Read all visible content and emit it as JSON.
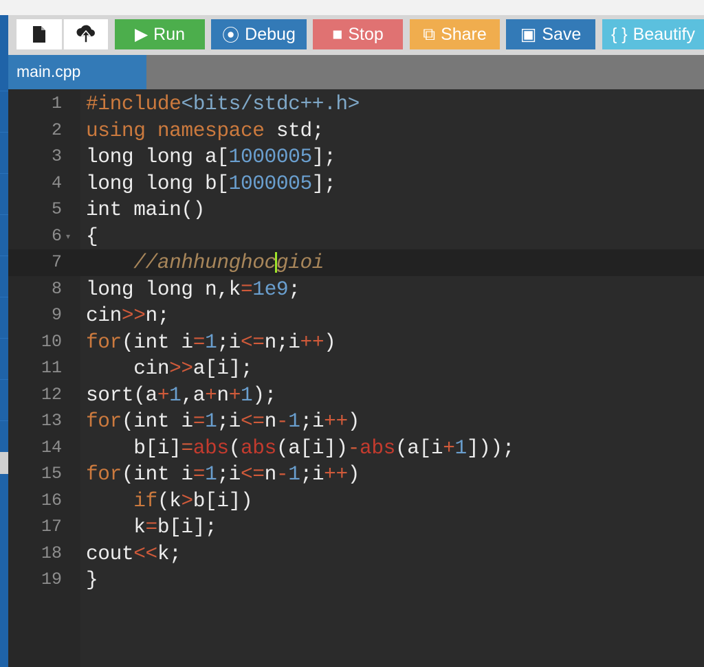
{
  "toolbar": {
    "new_file_icon": "file-icon",
    "upload_icon": "cloud-upload-icon",
    "buttons": [
      {
        "label": "Run",
        "icon": "▶",
        "color": "#4cae4c"
      },
      {
        "label": "Debug",
        "icon": "⦿",
        "color": "#337ab7"
      },
      {
        "label": "Stop",
        "icon": "■",
        "color": "#e07272"
      },
      {
        "label": "Share",
        "icon": "⧉",
        "color": "#f0ad4e"
      },
      {
        "label": "Save",
        "icon": "▣",
        "color": "#337ab7"
      },
      {
        "label": "Beautify",
        "icon": "{ }",
        "color": "#5bc0de"
      }
    ]
  },
  "tabs": [
    {
      "label": "main.cpp",
      "active": true
    }
  ],
  "editor": {
    "active_line": 7,
    "lines": [
      [
        [
          "#include",
          "kw"
        ],
        [
          "<bits/stdc++.h>",
          "str"
        ]
      ],
      [
        [
          "using namespace",
          "kw"
        ],
        [
          " std;",
          "pl"
        ]
      ],
      [
        [
          "long long a[",
          "pl"
        ],
        [
          "1000005",
          "num"
        ],
        [
          "];",
          "pl"
        ]
      ],
      [
        [
          "long long b[",
          "pl"
        ],
        [
          "1000005",
          "num"
        ],
        [
          "];",
          "pl"
        ]
      ],
      [
        [
          "int main()",
          "pl"
        ]
      ],
      [
        [
          "{",
          "pl"
        ]
      ],
      [
        [
          "    //anhhunghoc",
          "cm"
        ],
        [
          "|",
          "cursor"
        ],
        [
          "gioi",
          "cm"
        ]
      ],
      [
        [
          "long long n,k",
          "pl"
        ],
        [
          "=",
          "op"
        ],
        [
          "1e9",
          "num"
        ],
        [
          ";",
          "pl"
        ]
      ],
      [
        [
          "cin",
          "pl"
        ],
        [
          ">>",
          "op"
        ],
        [
          "n;",
          "pl"
        ]
      ],
      [
        [
          "for",
          "kw"
        ],
        [
          "(int i",
          "pl"
        ],
        [
          "=",
          "op"
        ],
        [
          "1",
          "num"
        ],
        [
          ";i",
          "pl"
        ],
        [
          "<=",
          "op"
        ],
        [
          "n;i",
          "pl"
        ],
        [
          "++",
          "op"
        ],
        [
          ")",
          "pl"
        ]
      ],
      [
        [
          "    cin",
          "pl"
        ],
        [
          ">>",
          "op"
        ],
        [
          "a[i];",
          "pl"
        ]
      ],
      [
        [
          "sort(a",
          "pl"
        ],
        [
          "+",
          "op"
        ],
        [
          "1",
          "num"
        ],
        [
          ",a",
          "pl"
        ],
        [
          "+",
          "op"
        ],
        [
          "n",
          "pl"
        ],
        [
          "+",
          "op"
        ],
        [
          "1",
          "num"
        ],
        [
          ");",
          "pl"
        ]
      ],
      [
        [
          "for",
          "kw"
        ],
        [
          "(int i",
          "pl"
        ],
        [
          "=",
          "op"
        ],
        [
          "1",
          "num"
        ],
        [
          ";i",
          "pl"
        ],
        [
          "<=",
          "op"
        ],
        [
          "n",
          "pl"
        ],
        [
          "-",
          "op"
        ],
        [
          "1",
          "num"
        ],
        [
          ";i",
          "pl"
        ],
        [
          "++",
          "op"
        ],
        [
          ")",
          "pl"
        ]
      ],
      [
        [
          "    b[i]",
          "pl"
        ],
        [
          "=",
          "op"
        ],
        [
          "abs",
          "fn"
        ],
        [
          "(",
          "pl"
        ],
        [
          "abs",
          "fn"
        ],
        [
          "(a[i])",
          "pl"
        ],
        [
          "-",
          "op"
        ],
        [
          "abs",
          "fn"
        ],
        [
          "(a[i",
          "pl"
        ],
        [
          "+",
          "op"
        ],
        [
          "1",
          "num"
        ],
        [
          "]));",
          "pl"
        ]
      ],
      [
        [
          "for",
          "kw"
        ],
        [
          "(int i",
          "pl"
        ],
        [
          "=",
          "op"
        ],
        [
          "1",
          "num"
        ],
        [
          ";i",
          "pl"
        ],
        [
          "<=",
          "op"
        ],
        [
          "n",
          "pl"
        ],
        [
          "-",
          "op"
        ],
        [
          "1",
          "num"
        ],
        [
          ";i",
          "pl"
        ],
        [
          "++",
          "op"
        ],
        [
          ")",
          "pl"
        ]
      ],
      [
        [
          "    ",
          "pl"
        ],
        [
          "if",
          "kw"
        ],
        [
          "(k",
          "pl"
        ],
        [
          ">",
          "op"
        ],
        [
          "b[i])",
          "pl"
        ]
      ],
      [
        [
          "    k",
          "pl"
        ],
        [
          "=",
          "op"
        ],
        [
          "b[i];",
          "pl"
        ]
      ],
      [
        [
          "cout",
          "pl"
        ],
        [
          "<<",
          "op"
        ],
        [
          "k;",
          "pl"
        ]
      ],
      [
        [
          "}",
          "pl"
        ]
      ]
    ]
  }
}
